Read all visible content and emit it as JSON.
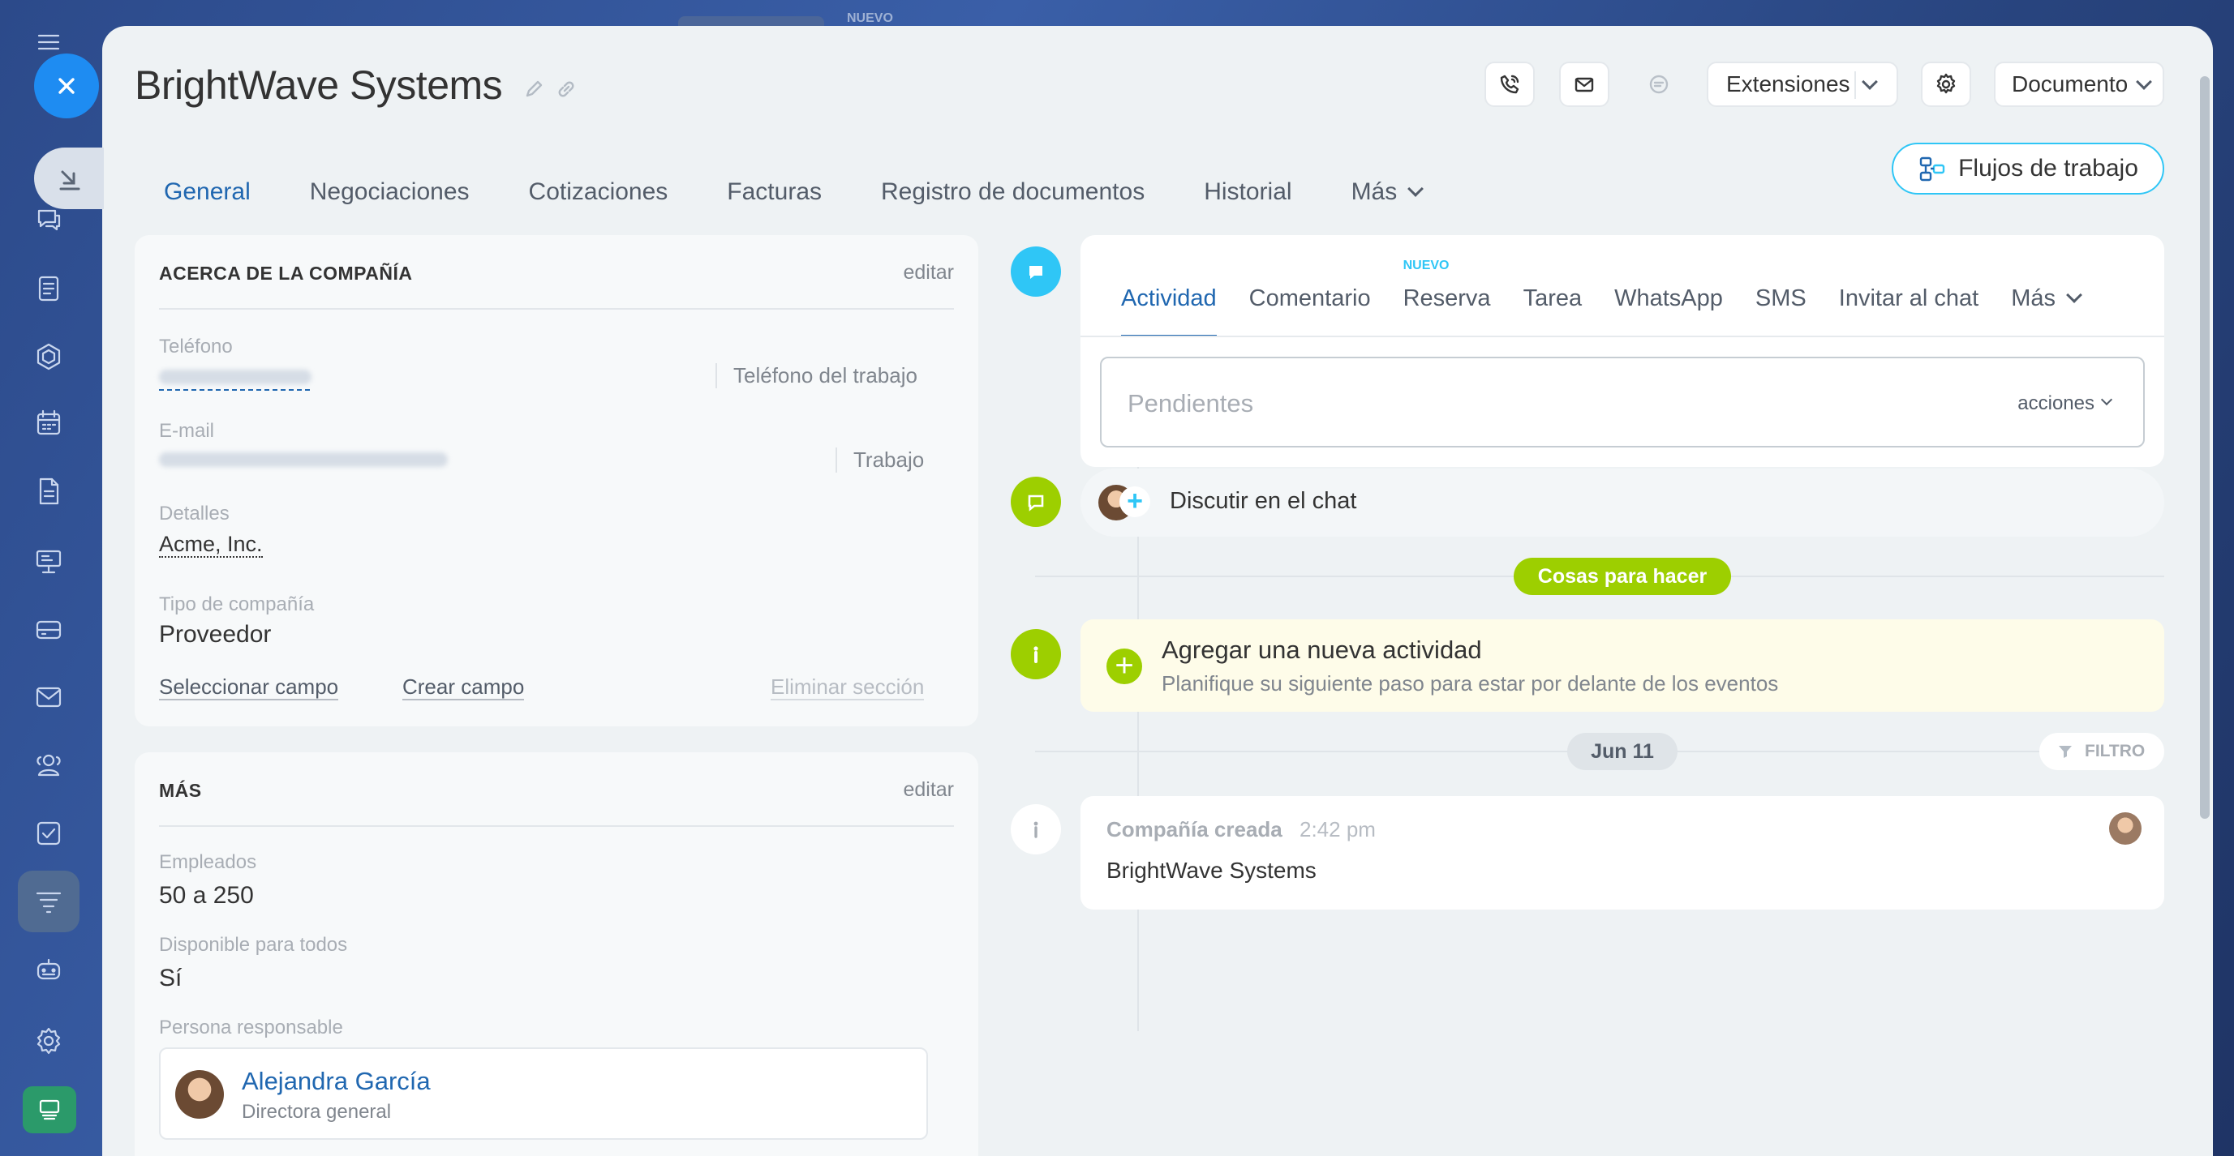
{
  "colors": {
    "accent": "#2067b0",
    "brand": "#2fc6f6",
    "green": "#9dcf00",
    "close": "#1e8cf2"
  },
  "topstrip": {
    "badge": "NUEVO"
  },
  "sidebar": {
    "icons": [
      "menu-icon",
      "close-icon",
      "collapse-icon",
      "chat-icon",
      "feed-icon",
      "hexagon-icon",
      "calendar-icon",
      "document-icon",
      "presentation-icon",
      "inbox-icon",
      "mail-icon",
      "contacts-icon",
      "tasks-icon",
      "funnel-icon",
      "robot-icon",
      "settings-icon",
      "market-icon"
    ]
  },
  "header": {
    "title": "BrightWave Systems",
    "extensiones": "Extensiones",
    "documento": "Documento",
    "flujos": "Flujos de trabajo"
  },
  "tabs": [
    {
      "label": "General"
    },
    {
      "label": "Negociaciones"
    },
    {
      "label": "Cotizaciones"
    },
    {
      "label": "Facturas"
    },
    {
      "label": "Registro de documentos"
    },
    {
      "label": "Historial"
    },
    {
      "label": "Más"
    }
  ],
  "about": {
    "title": "ACERCA DE LA COMPAÑÍA",
    "edit": "editar",
    "phone_label": "Teléfono",
    "phone_type": "Teléfono del trabajo",
    "email_label": "E-mail",
    "email_type": "Trabajo",
    "details_label": "Detalles",
    "details_value": "Acme, Inc.",
    "company_type_label": "Tipo de compañía",
    "company_type_value": "Proveedor",
    "select_field": "Seleccionar campo",
    "create_field": "Crear campo",
    "delete_section": "Eliminar sección"
  },
  "more": {
    "title": "MÁS",
    "edit": "editar",
    "employees_label": "Empleados",
    "employees_value": "50 a 250",
    "available_label": "Disponible para todos",
    "available_value": "Sí",
    "responsible_label": "Persona responsable",
    "responsible_name": "Alejandra García",
    "responsible_role": "Directora general"
  },
  "activity": {
    "tabs": [
      "Actividad",
      "Comentario",
      "Reserva",
      "Tarea",
      "WhatsApp",
      "SMS",
      "Invitar al chat",
      "Más"
    ],
    "nuevo_badge": "NUEVO",
    "pending_placeholder": "Pendientes",
    "actions": "acciones",
    "chat_label": "Discutir en el chat",
    "todo_badge": "Cosas para hacer",
    "add_title": "Agregar una nueva actividad",
    "add_subtitle": "Planifique su siguiente paso para estar por delante de los eventos",
    "date_badge": "Jun 11",
    "filter": "FILTRO",
    "created_title": "Compañía creada",
    "created_time": "2:42 pm",
    "created_body": "BrightWave Systems"
  }
}
